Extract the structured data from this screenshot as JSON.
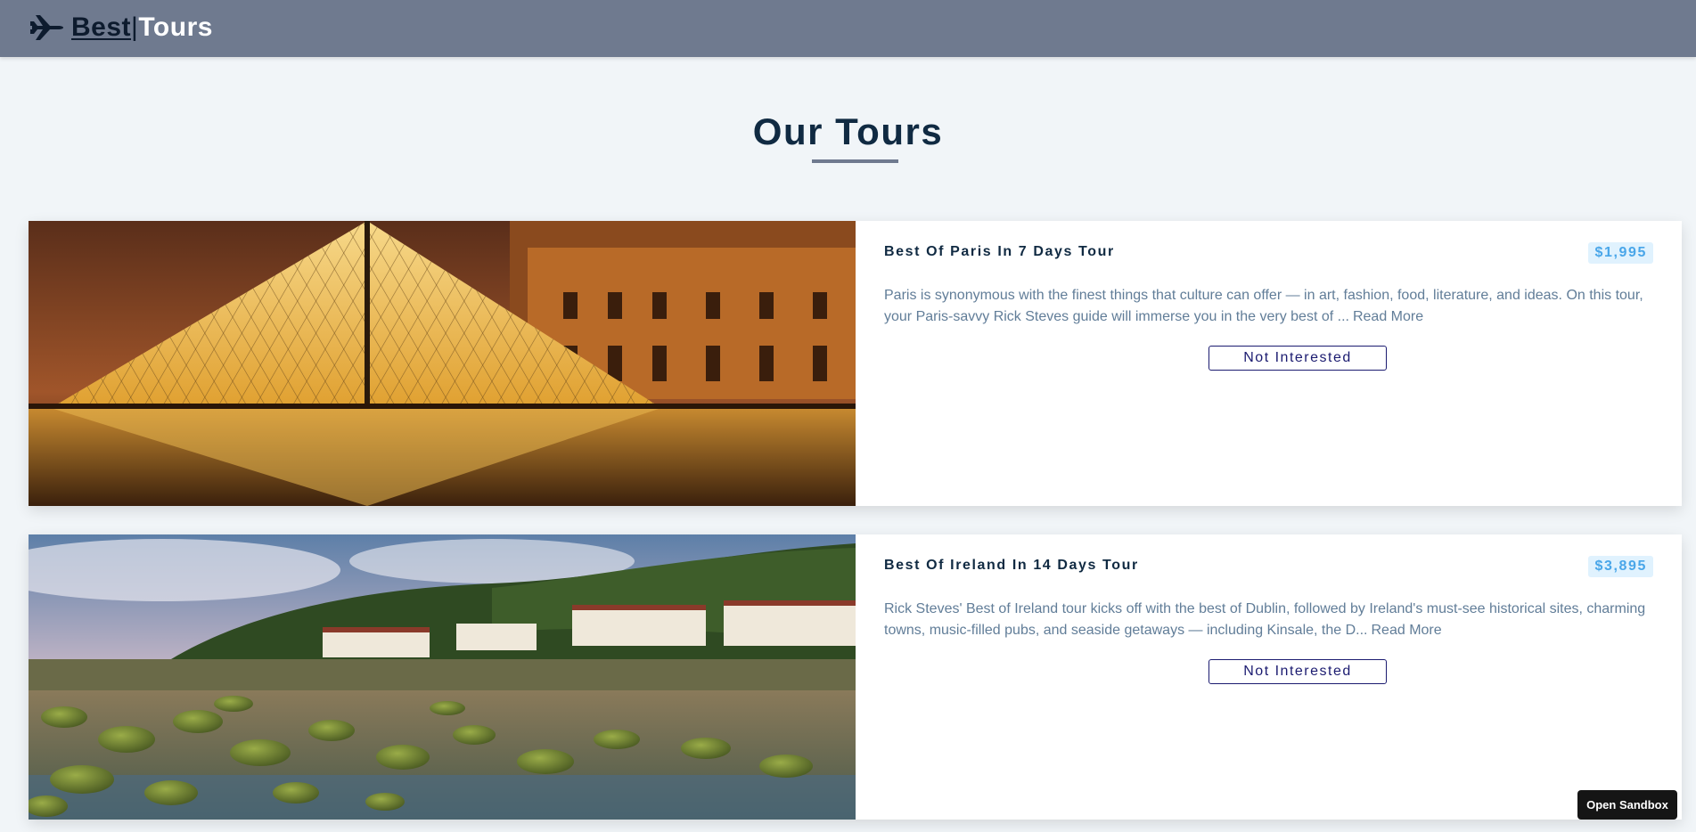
{
  "navbar": {
    "logo_icon": "airplane-icon",
    "brand_best": "Best",
    "brand_separator": "|",
    "brand_tours": "Tours"
  },
  "section": {
    "title": "Our Tours"
  },
  "tours": [
    {
      "name": "Best Of Paris In 7 Days Tour",
      "price": "$1,995",
      "description": "Paris is synonymous with the finest things that culture can offer — in art, fashion, food, literature, and ideas. On this tour, your Paris-savvy Rick Steves guide will immerse you in the very best of ...",
      "read_more": "Read More",
      "button": "Not Interested"
    },
    {
      "name": "Best Of Ireland In 14 Days Tour",
      "price": "$3,895",
      "description": "Rick Steves' Best of Ireland tour kicks off with the best of Dublin, followed by Ireland's must-see historical sites, charming towns, music-filled pubs, and seaside getaways — including Kinsale, the D...",
      "read_more": "Read More",
      "button": "Not Interested"
    }
  ],
  "sandbox": {
    "label": "Open Sandbox"
  },
  "colors": {
    "navbar": "#6f7a8f",
    "title": "#102a42",
    "price_bg": "#e0f2fe",
    "price_text": "#49a6e9",
    "body_text": "#617d98",
    "button_border": "#1b1b70"
  }
}
